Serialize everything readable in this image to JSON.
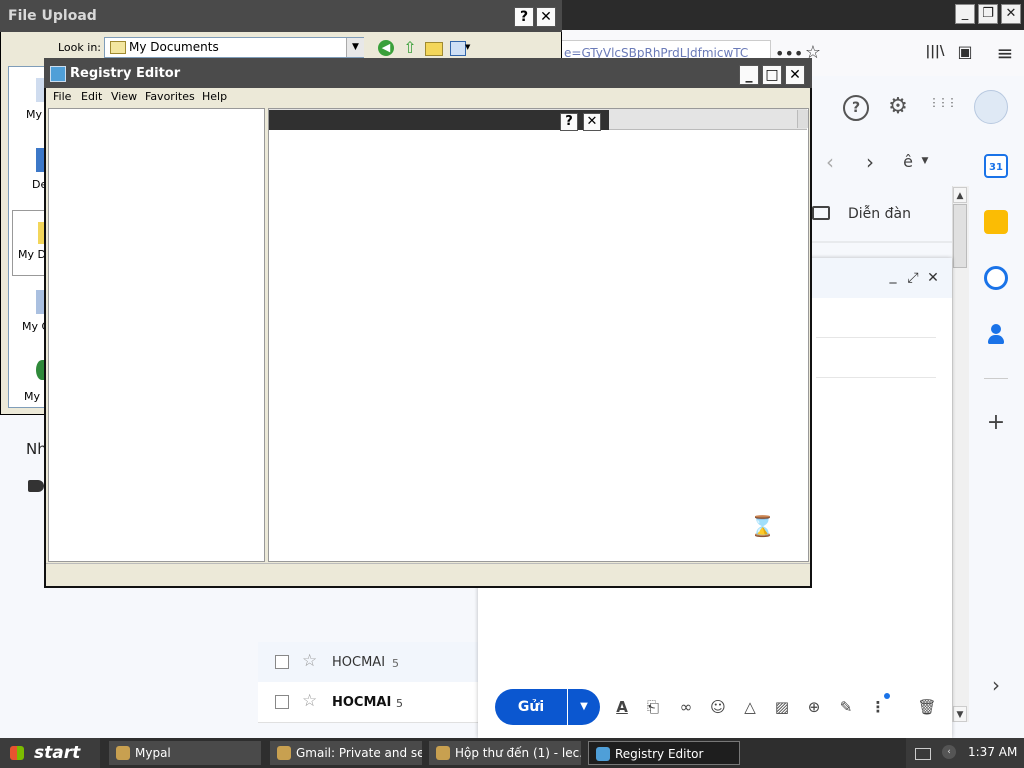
{
  "browser": {
    "url_text": "e=GTyVlcSBpRhPrdLJdfmicwTC",
    "more_glyph": "•••",
    "star_glyph": "☆",
    "library_glyph": "|||\\",
    "sidebar_glyph": "▣",
    "menu_glyph": "≡",
    "minimize": "_",
    "restore": "❐",
    "close": "✕"
  },
  "gmail": {
    "forum_label": "Diễn đàn",
    "left_truncated": "Nh",
    "nav_prev": "‹",
    "nav_next": "›",
    "input_tool": "ê",
    "help_glyph": "?",
    "settings_glyph": "⚙",
    "apps_glyph": "⋮⋮⋮",
    "calendar_num": "31",
    "add_glyph": "+",
    "expand_glyph": "›",
    "compose_min": "_",
    "compose_expand": "⤢",
    "compose_close": "✕",
    "send_label": "Gửi",
    "send_drop": "▼",
    "rows": [
      {
        "sender": "HOCMAI",
        "count": "5",
        "bold": false
      },
      {
        "sender": "HOCMAI",
        "count": "5",
        "bold": true
      }
    ]
  },
  "file_upload": {
    "title": "File Upload",
    "help": "?",
    "close": "✕",
    "look_in_label": "Look in:",
    "look_in_value": "My Documents",
    "places": [
      "My Doc",
      "De",
      "My Do",
      "My C",
      "My N"
    ]
  },
  "registry": {
    "title": "Registry Editor",
    "menus": [
      "File",
      "Edit",
      "View",
      "Favorites",
      "Help"
    ],
    "minimize": "_",
    "maximize": "□",
    "close": "✕",
    "inner_help": "?",
    "inner_close": "✕",
    "hourglass": "⌛"
  },
  "taskbar": {
    "start_label": "start",
    "tasks": [
      {
        "label": "Mypal",
        "active": false
      },
      {
        "label": "Gmail: Private and se...",
        "active": false
      },
      {
        "label": "Hộp thư đến (1) - lec...",
        "active": false
      },
      {
        "label": "Registry Editor",
        "active": true
      }
    ],
    "clock": "1:37 AM"
  }
}
